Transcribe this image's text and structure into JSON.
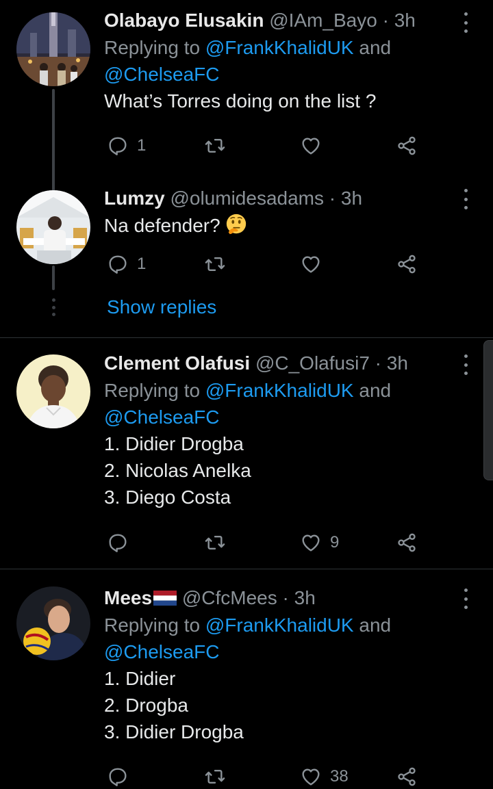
{
  "tweets": [
    {
      "name": "Olabayo Elusakin",
      "handle": "@IAm_Bayo",
      "dot": "·",
      "time": "3h",
      "replying_prefix": "Replying to ",
      "mention1": "@FrankKhalidUK",
      "and": " and",
      "mention2": "@ChelseaFC",
      "text": "What’s Torres doing on the list ?",
      "reply_count": "1",
      "like_count": ""
    },
    {
      "name": "Lumzy",
      "handle": "@olumidesadams",
      "dot": "·",
      "time": "3h",
      "text": "Na defender?",
      "emoji": "thinking-face-emoji",
      "reply_count": "1",
      "like_count": ""
    },
    {
      "name": "Clement Olafusi",
      "handle": "@C_Olafusi7",
      "dot": "·",
      "time": "3h",
      "replying_prefix": "Replying to ",
      "mention1": "@FrankKhalidUK",
      "and": " and",
      "mention2": "@ChelseaFC",
      "lines": [
        "1. Didier Drogba",
        "2. Nicolas Anelka",
        "3. Diego Costa"
      ],
      "reply_count": "",
      "like_count": "9"
    },
    {
      "name": "Mees",
      "flag": "netherlands-flag-emoji",
      "handle": "@CfcMees",
      "dot": "·",
      "time": "3h",
      "replying_prefix": "Replying to ",
      "mention1": "@FrankKhalidUK",
      "and": " and",
      "mention2": "@ChelseaFC",
      "lines": [
        "1. Didier",
        "2. Drogba",
        "3. Didier Drogba"
      ],
      "reply_count": "",
      "like_count": "38"
    }
  ],
  "show_replies": "Show replies",
  "icons": {
    "reply": "reply-icon",
    "retweet": "retweet-icon",
    "like": "heart-icon",
    "share": "share-icon",
    "more": "more-options-icon"
  },
  "colors": {
    "background": "#000000",
    "accent": "#1d9bf0",
    "muted": "#8b9298",
    "text": "#e7e9ea"
  }
}
